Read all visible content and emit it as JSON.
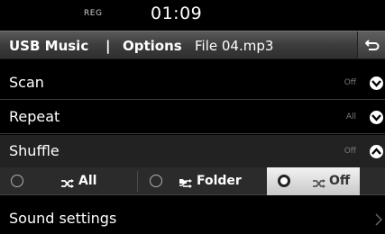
{
  "status": {
    "reg": "REG",
    "time": "01:09"
  },
  "title": {
    "main": "USB Music",
    "separator": "|",
    "section": "Options",
    "file": "File 04.mp3"
  },
  "menu": [
    {
      "label": "Scan",
      "value": "Off"
    },
    {
      "label": "Repeat",
      "value": "All"
    },
    {
      "label": "Shuffle",
      "value": "Off"
    }
  ],
  "shuffle_options": [
    {
      "label": "All",
      "icon": "shuffle-icon",
      "selected": false
    },
    {
      "label": "Folder",
      "icon": "folder-shuffle-icon",
      "selected": false
    },
    {
      "label": "Off",
      "icon": "shuffle-icon",
      "selected": true
    }
  ],
  "sound": {
    "label": "Sound settings"
  }
}
